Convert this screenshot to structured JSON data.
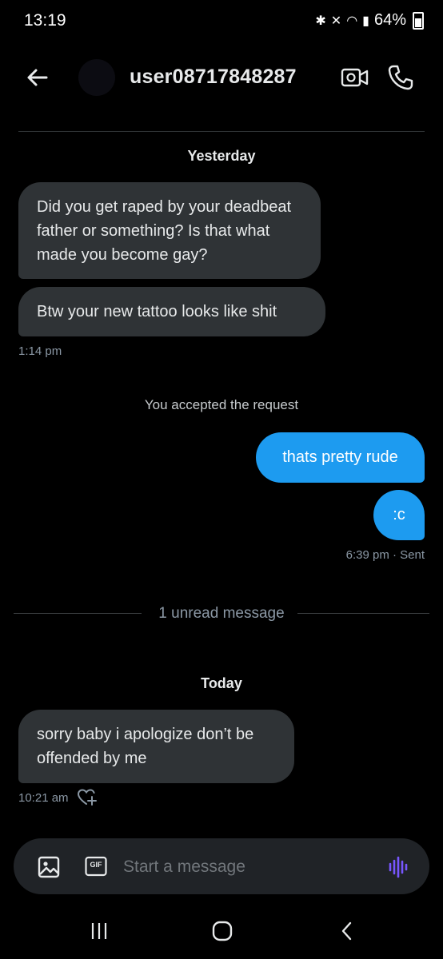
{
  "status_bar": {
    "time": "13:19",
    "battery": "64%"
  },
  "header": {
    "username": "user08717848287"
  },
  "conversation": {
    "yesterday_label": "Yesterday",
    "incoming_group_1": [
      "Did you get raped by your deadbeat father or something? Is that what made you become gay?",
      "Btw your new tattoo looks like shit"
    ],
    "incoming_group_1_time": "1:14 pm",
    "system_note": "You accepted the request",
    "outgoing_group": [
      "thats pretty rude",
      ":c"
    ],
    "outgoing_time": "6:39 pm · Sent",
    "unread_divider": "1 unread message",
    "today_label": "Today",
    "incoming_group_2": [
      "sorry baby i apologize don’t be offended by me"
    ],
    "incoming_group_2_time": "10:21 am"
  },
  "composer": {
    "placeholder": "Start a message",
    "gif_label": "GIF"
  },
  "colors": {
    "accent": "#1d9bf0",
    "incoming_bubble": "#2f3336",
    "voice_icon": "#7856ff"
  }
}
